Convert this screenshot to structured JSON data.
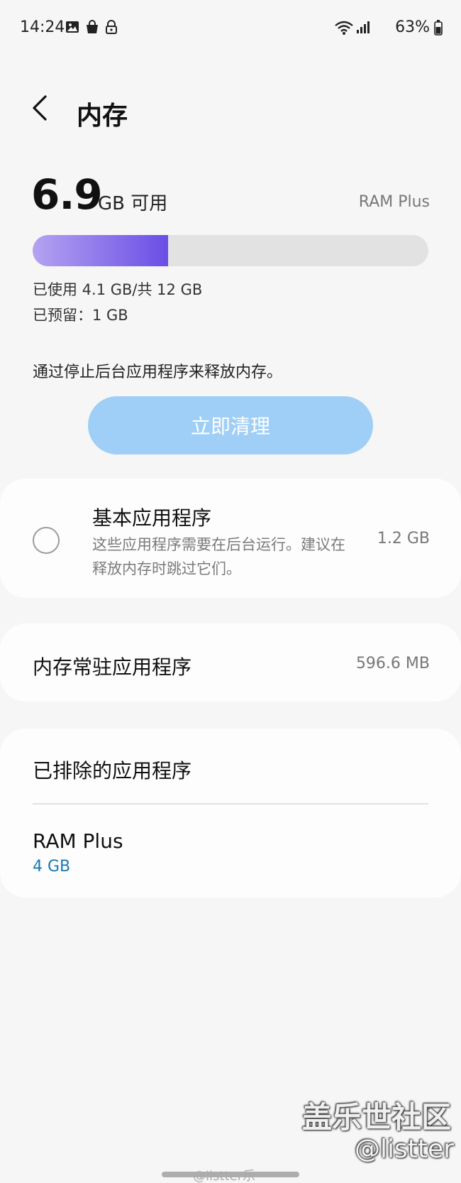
{
  "status_bar": {
    "time": "14:24",
    "battery_percent": "63%",
    "left_icons": [
      "gallery-icon",
      "shopping-bag-icon",
      "lock-icon"
    ],
    "right_icons": [
      "wifi-icon",
      "signal-icon",
      "battery-icon"
    ]
  },
  "header": {
    "title": "内存",
    "back_icon": "chevron-left-icon"
  },
  "summary": {
    "available_value": "6.9",
    "available_unit": "GB 可用",
    "ram_plus_link": "RAM Plus",
    "usage_fraction": 0.342,
    "used_text": "已使用 4.1 GB/共 12 GB",
    "reserved_text": "已预留：1 GB",
    "hint": "通过停止后台应用程序来释放内存。",
    "clean_button": "立即清理",
    "colors": {
      "bar_start": "#b4a3f0",
      "bar_end": "#6a4ee6",
      "button": "#9fcff6",
      "accent_value": "#1a78b4"
    }
  },
  "basic_apps": {
    "title": "基本应用程序",
    "description": "这些应用程序需要在后台运行。建议在释放内存时跳过它们。",
    "size": "1.2 GB"
  },
  "resident_apps": {
    "label": "内存常驻应用程序",
    "size": "596.6 MB"
  },
  "excluded": {
    "label": "已排除的应用程序",
    "ram_plus_title": "RAM Plus",
    "ram_plus_value": "4 GB"
  },
  "watermarks": {
    "community": "盖乐世社区",
    "handle": "@listter",
    "weibo": "@listter乐"
  }
}
